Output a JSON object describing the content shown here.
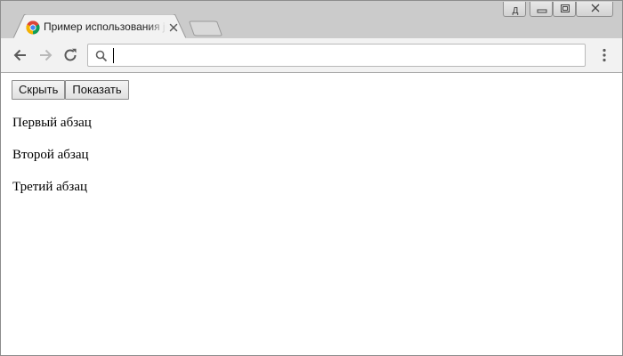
{
  "browser": {
    "tab": {
      "title": "Пример использования jQuery",
      "favicon": "chrome-logo-icon",
      "close_icon": "close-icon"
    },
    "new_tab_icon": "new-tab-icon",
    "window_controls": {
      "user_badge": "Д",
      "minimize_icon": "minimize-icon",
      "restore_icon": "restore-icon",
      "close_icon": "close-icon"
    },
    "toolbar": {
      "back_icon": "back-arrow-icon",
      "forward_icon": "forward-arrow-icon",
      "reload_icon": "reload-icon",
      "search_icon": "search-icon",
      "address_value": "",
      "menu_icon": "more-vert-icon"
    }
  },
  "page": {
    "buttons": {
      "hide_label": "Скрыть",
      "show_label": "Показать"
    },
    "paragraphs": [
      "Первый абзац",
      "Второй абзац",
      "Третий абзац"
    ]
  },
  "colors": {
    "tabstrip": "#cbcbcb",
    "toolbar": "#f2f2f2",
    "active_tab": "#f2f2f2",
    "page_background": "#ffffff"
  }
}
